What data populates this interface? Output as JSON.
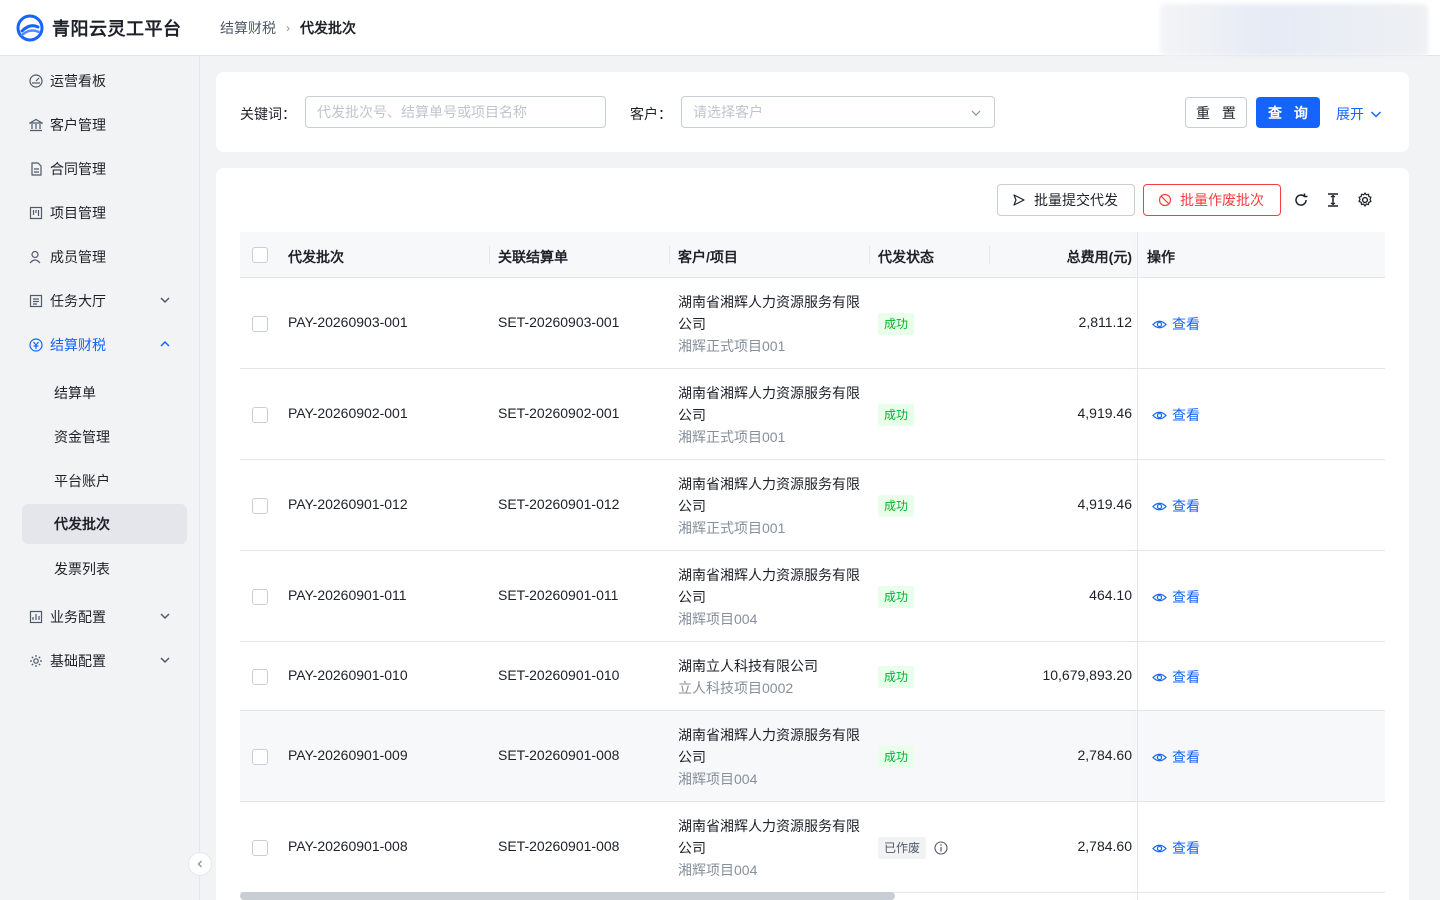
{
  "app": {
    "title": "青阳云灵工平台"
  },
  "breadcrumb": {
    "parent": "结算财税",
    "current": "代发批次"
  },
  "sidebar": {
    "items": [
      {
        "label": "运营看板",
        "icon": "dashboard-icon"
      },
      {
        "label": "客户管理",
        "icon": "bank-icon"
      },
      {
        "label": "合同管理",
        "icon": "contract-icon"
      },
      {
        "label": "项目管理",
        "icon": "project-icon"
      },
      {
        "label": "成员管理",
        "icon": "member-icon"
      },
      {
        "label": "任务大厅",
        "icon": "task-icon",
        "expandable": true
      },
      {
        "label": "结算财税",
        "icon": "settlement-icon",
        "expanded": true
      },
      {
        "label": "业务配置",
        "icon": "business-config-icon",
        "expandable": true
      },
      {
        "label": "基础配置",
        "icon": "gear-icon",
        "expandable": true
      }
    ],
    "sub_items": [
      "结算单",
      "资金管理",
      "平台账户",
      "代发批次",
      "发票列表"
    ],
    "selected_sub": "代发批次"
  },
  "filter": {
    "keyword_label": "关键词：",
    "keyword_placeholder": "代发批次号、结算单号或项目名称",
    "customer_label": "客户：",
    "customer_placeholder": "请选择客户",
    "reset_label": "重 置",
    "query_label": "查 询",
    "expand_label": "展开"
  },
  "toolbar": {
    "submit_label": "批量提交代发",
    "void_label": "批量作废批次"
  },
  "table": {
    "headers": [
      "代发批次",
      "关联结算单",
      "客户/项目",
      "代发状态",
      "总费用(元)",
      "操作"
    ],
    "view_label": "查看",
    "rows": [
      {
        "batch": "PAY-20260903-001",
        "settlement": "SET-20260903-001",
        "customer": "湖南省湘辉人力资源服务有限公司",
        "project": "湘辉正式项目001",
        "status": "成功",
        "amount": "2,811.12"
      },
      {
        "batch": "PAY-20260902-001",
        "settlement": "SET-20260902-001",
        "customer": "湖南省湘辉人力资源服务有限公司",
        "project": "湘辉正式项目001",
        "status": "成功",
        "amount": "4,919.46"
      },
      {
        "batch": "PAY-20260901-012",
        "settlement": "SET-20260901-012",
        "customer": "湖南省湘辉人力资源服务有限公司",
        "project": "湘辉正式项目001",
        "status": "成功",
        "amount": "4,919.46"
      },
      {
        "batch": "PAY-20260901-011",
        "settlement": "SET-20260901-011",
        "customer": "湖南省湘辉人力资源服务有限公司",
        "project": "湘辉项目004",
        "status": "成功",
        "amount": "464.10"
      },
      {
        "batch": "PAY-20260901-010",
        "settlement": "SET-20260901-010",
        "customer": "湖南立人科技有限公司",
        "project": "立人科技项目0002",
        "status": "成功",
        "amount": "10,679,893.20"
      },
      {
        "batch": "PAY-20260901-009",
        "settlement": "SET-20260901-008",
        "customer": "湖南省湘辉人力资源服务有限公司",
        "project": "湘辉项目004",
        "status": "成功",
        "amount": "2,784.60"
      },
      {
        "batch": "PAY-20260901-008",
        "settlement": "SET-20260901-008",
        "customer": "湖南省湘辉人力资源服务有限公司",
        "project": "湘辉项目004",
        "status": "已作废",
        "amount": "2,784.60"
      }
    ]
  },
  "colors": {
    "primary": "#1664ff",
    "danger": "#f53f3f",
    "success": "#00b42a"
  }
}
